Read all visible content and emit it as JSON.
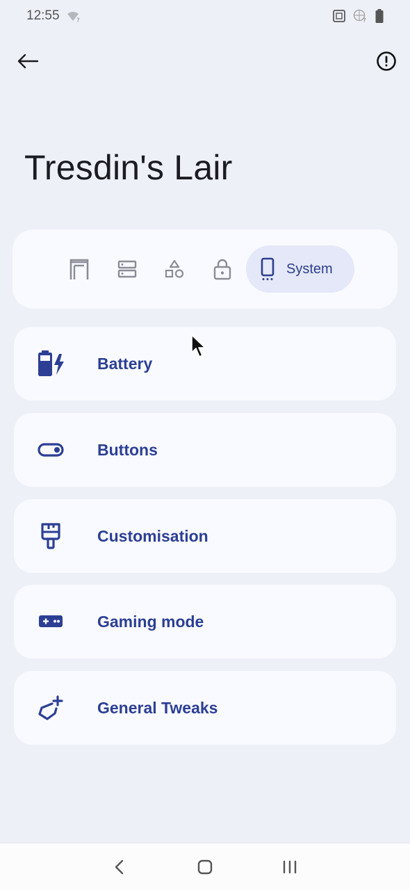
{
  "status_bar": {
    "time": "12:55"
  },
  "title": "Tresdin's Lair",
  "tabs": [
    {
      "icon": "door-frame-icon"
    },
    {
      "icon": "storage-icon"
    },
    {
      "icon": "shapes-icon"
    },
    {
      "icon": "lock-icon"
    },
    {
      "icon": "phone-icon",
      "label": "System",
      "selected": true
    }
  ],
  "items": [
    {
      "label": "Battery",
      "icon": "battery-charging-icon"
    },
    {
      "label": "Buttons",
      "icon": "toggle-icon"
    },
    {
      "label": "Customisation",
      "icon": "paintbrush-icon"
    },
    {
      "label": "Gaming mode",
      "icon": "gamepad-icon"
    },
    {
      "label": "General Tweaks",
      "icon": "tag-plus-icon"
    }
  ],
  "colors": {
    "accent": "#2c3f94",
    "background": "#eef0f8",
    "card": "#f9faff",
    "inactive_icon": "#8a8d96"
  }
}
